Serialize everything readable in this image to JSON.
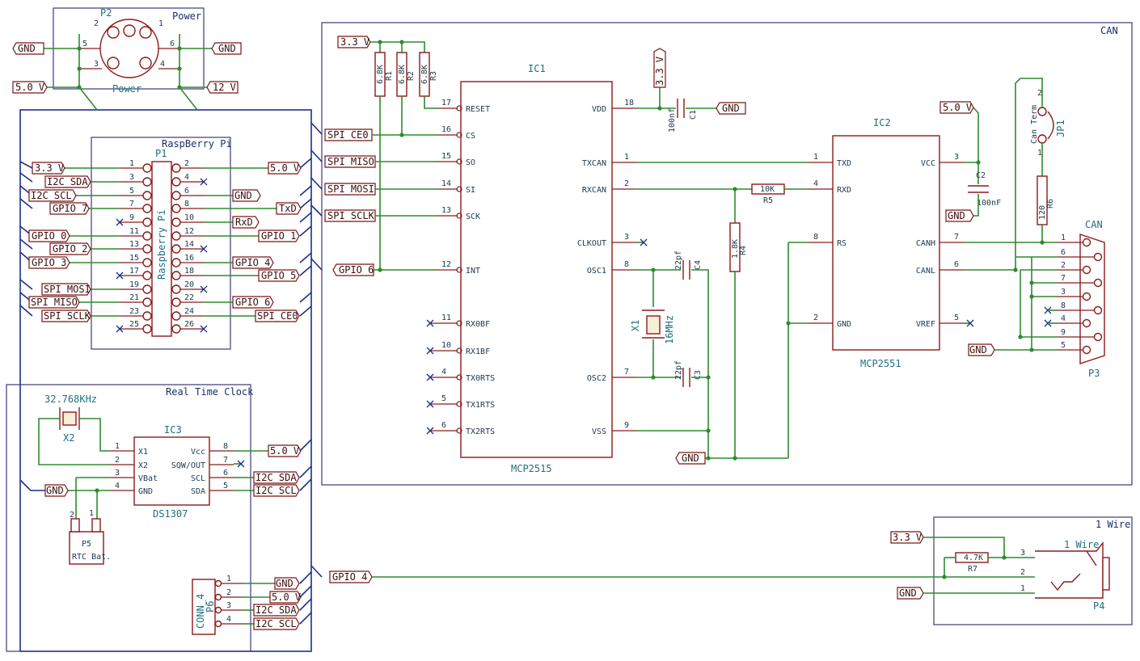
{
  "sheets": {
    "can": "CAN",
    "rpi": "RaspBerry Pi",
    "rtc": "Real Time Clock",
    "onewire": "1 Wire",
    "power": "Power"
  },
  "net_labels": {
    "gnd": "GND",
    "v33": "3.3 V",
    "v50": "5.0 V",
    "v12": "12 V",
    "spi_ce0": "SPI_CE0",
    "spi_miso": "SPI_MISO",
    "spi_mosi": "SPI_MOSI",
    "spi_sclk": "SPI_SCLK",
    "gpio6": "GPIO 6",
    "gpio4": "GPIO 4",
    "gpio7": "GPIO 7",
    "gpio0": "GPIO 0",
    "gpio1": "GPIO 1",
    "gpio2": "GPIO 2",
    "gpio3": "GPIO 3",
    "gpio5": "GPIO 5",
    "i2c_sda": "I2C_SDA",
    "i2c_scl": "I2C_SCL",
    "txd": "TxD",
    "rxd": "RxD"
  },
  "power_conn": {
    "ref": "P2",
    "value": "Power",
    "title": "Power",
    "pins": [
      "1",
      "2",
      "3",
      "4",
      "5",
      "6"
    ]
  },
  "rpi_header": {
    "ref": "P1",
    "value": "Raspberry Pi",
    "left_pins": [
      "1",
      "3",
      "5",
      "7",
      "9",
      "11",
      "13",
      "15",
      "17",
      "19",
      "21",
      "23",
      "25"
    ],
    "right_pins": [
      "2",
      "4",
      "6",
      "8",
      "10",
      "12",
      "14",
      "16",
      "18",
      "20",
      "22",
      "24",
      "26"
    ]
  },
  "ic1": {
    "ref": "IC1",
    "value": "MCP2515",
    "left": [
      {
        "num": "17",
        "name": "RESET"
      },
      {
        "num": "16",
        "name": "CS"
      },
      {
        "num": "15",
        "name": "SO"
      },
      {
        "num": "14",
        "name": "SI"
      },
      {
        "num": "13",
        "name": "SCK"
      },
      {
        "num": "12",
        "name": "INT"
      },
      {
        "num": "11",
        "name": "RX0BF"
      },
      {
        "num": "10",
        "name": "RX1BF"
      },
      {
        "num": "4",
        "name": "TX0RTS"
      },
      {
        "num": "5",
        "name": "TX1RTS"
      },
      {
        "num": "6",
        "name": "TX2RTS"
      }
    ],
    "right": [
      {
        "num": "18",
        "name": "VDD"
      },
      {
        "num": "1",
        "name": "TXCAN"
      },
      {
        "num": "2",
        "name": "RXCAN"
      },
      {
        "num": "3",
        "name": "CLKOUT"
      },
      {
        "num": "8",
        "name": "OSC1"
      },
      {
        "num": "7",
        "name": "OSC2"
      },
      {
        "num": "9",
        "name": "VSS"
      }
    ]
  },
  "ic2": {
    "ref": "IC2",
    "value": "MCP2551",
    "left": [
      {
        "num": "1",
        "name": "TXD"
      },
      {
        "num": "4",
        "name": "RXD"
      },
      {
        "num": "8",
        "name": "RS"
      },
      {
        "num": "2",
        "name": "GND"
      }
    ],
    "right": [
      {
        "num": "3",
        "name": "VCC"
      },
      {
        "num": "7",
        "name": "CANH"
      },
      {
        "num": "6",
        "name": "CANL"
      },
      {
        "num": "5",
        "name": "VREF"
      }
    ]
  },
  "ic3": {
    "ref": "IC3",
    "value": "DS1307",
    "left": [
      {
        "num": "1",
        "name": "X1"
      },
      {
        "num": "2",
        "name": "X2"
      },
      {
        "num": "3",
        "name": "VBat"
      },
      {
        "num": "4",
        "name": "GND"
      }
    ],
    "right": [
      {
        "num": "8",
        "name": "Vcc"
      },
      {
        "num": "7",
        "name": "SQW/OUT"
      },
      {
        "num": "6",
        "name": "SCL"
      },
      {
        "num": "5",
        "name": "SDA"
      }
    ]
  },
  "passives": {
    "r1": {
      "ref": "R1",
      "value": "6.8K"
    },
    "r2": {
      "ref": "R2",
      "value": "6.8K"
    },
    "r3": {
      "ref": "R3",
      "value": "6.8K"
    },
    "r4": {
      "ref": "R4",
      "value": "1.8K"
    },
    "r5": {
      "ref": "R5",
      "value": "10K"
    },
    "r6": {
      "ref": "R6",
      "value": "120"
    },
    "r7": {
      "ref": "R7",
      "value": "4.7K"
    },
    "c1": {
      "ref": "C1",
      "value": "100nf"
    },
    "c2": {
      "ref": "C2",
      "value": "100nF"
    },
    "c3": {
      "ref": "C3",
      "value": "22pf"
    },
    "c4": {
      "ref": "C4",
      "value": "22pf"
    },
    "x1": {
      "ref": "X1",
      "value": "16MHz"
    },
    "x2": {
      "ref": "X2",
      "value": "32.768KHz"
    },
    "jp1": {
      "ref": "JP1",
      "value": "Can Term",
      "pins": [
        "1",
        "2"
      ]
    },
    "p5": {
      "ref": "P5",
      "value": "RTC Bat.",
      "pins": [
        "2",
        "1"
      ]
    }
  },
  "p3": {
    "ref": "P3",
    "value": "CAN",
    "pins": [
      "1",
      "6",
      "2",
      "7",
      "3",
      "8",
      "4",
      "9",
      "5"
    ]
  },
  "p4": {
    "ref": "P4",
    "value": "1 Wire",
    "pins": [
      "3",
      "2",
      "1"
    ]
  },
  "p6": {
    "ref": "P6",
    "value": "CONN_4",
    "pins": [
      "1",
      "2",
      "3",
      "4"
    ]
  }
}
